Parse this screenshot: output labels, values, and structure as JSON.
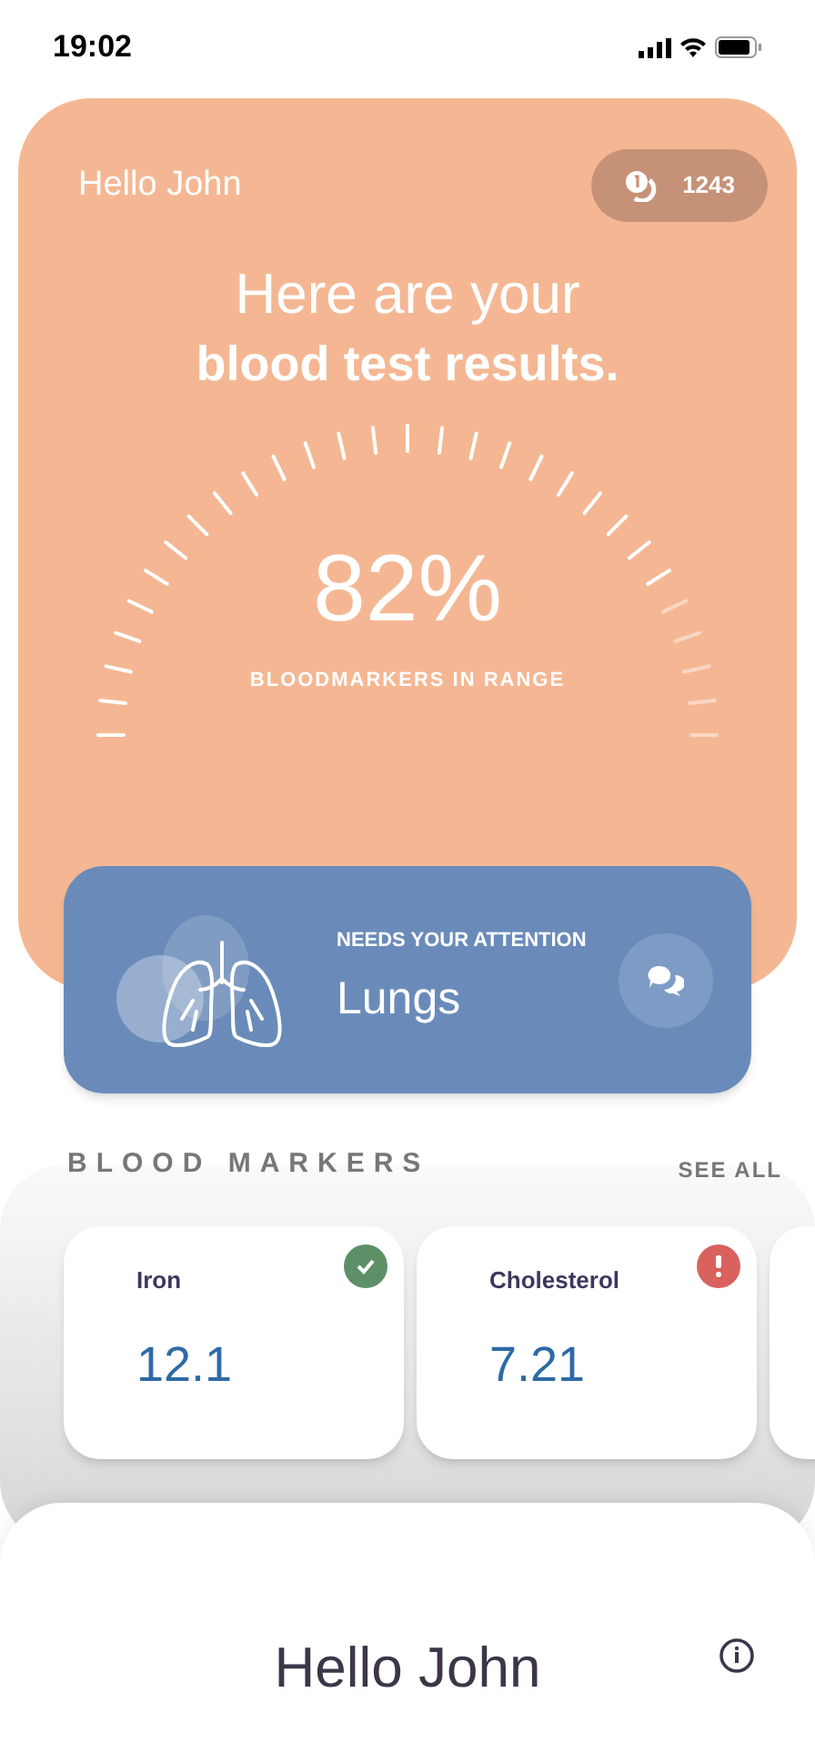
{
  "status_bar": {
    "time": "19:02"
  },
  "header": {
    "greeting": "Hello John",
    "points": "1243"
  },
  "headline": {
    "line_1": "Here are your",
    "line_2": "blood test results."
  },
  "gauge": {
    "level": 0.82,
    "value": "82%",
    "caption": "BLOODMARKERS IN RANGE"
  },
  "attention": {
    "label": "NEEDS YOUR ATTENTION",
    "organ": "Lungs"
  },
  "blood_markers": {
    "title": "BLOOD MARKERS",
    "see_all": "SEE ALL",
    "items": [
      {
        "name": "Iron",
        "value": "12.1",
        "in_range": true,
        "color": "#5e9068"
      },
      {
        "name": "Cholesterol",
        "value": "7.21",
        "in_range": false,
        "color": "#d9625e"
      }
    ]
  },
  "sheet": {
    "title": "Hello John"
  }
}
